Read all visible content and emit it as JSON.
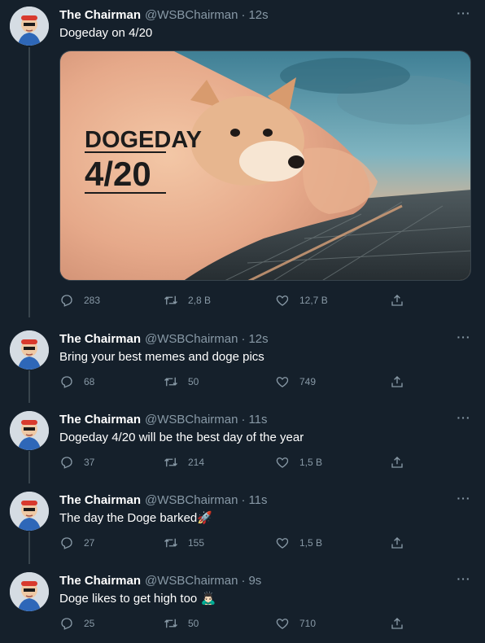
{
  "tweets": [
    {
      "name": "The Chairman",
      "handle": "@WSBChairman",
      "separator": "·",
      "time": "12s",
      "text": "Dogeday on 4/20",
      "media": {
        "line1": "DOGEDAY",
        "line2": "4/20"
      },
      "reply_count": "283",
      "retweet_count": "2,8 B",
      "like_count": "12,7 B"
    },
    {
      "name": "The Chairman",
      "handle": "@WSBChairman",
      "separator": "·",
      "time": "12s",
      "text": "Bring your best memes and doge pics",
      "reply_count": "68",
      "retweet_count": "50",
      "like_count": "749"
    },
    {
      "name": "The Chairman",
      "handle": "@WSBChairman",
      "separator": "·",
      "time": "11s",
      "text": "Dogeday 4/20 will be the best day of the year",
      "reply_count": "37",
      "retweet_count": "214",
      "like_count": "1,5 B"
    },
    {
      "name": "The Chairman",
      "handle": "@WSBChairman",
      "separator": "·",
      "time": "11s",
      "text": "The day the Doge barked🚀",
      "reply_count": "27",
      "retweet_count": "155",
      "like_count": "1,5 B"
    },
    {
      "name": "The Chairman",
      "handle": "@WSBChairman",
      "separator": "·",
      "time": "9s",
      "text": "Doge likes to get high too 🙇🏻‍♂️",
      "reply_count": "25",
      "retweet_count": "50",
      "like_count": "710"
    }
  ],
  "more_glyph": "···",
  "colors": {
    "background": "#15202b",
    "secondary_text": "#8899a6",
    "thread_line": "#38444d"
  },
  "icons": [
    "reply-icon",
    "retweet-icon",
    "like-icon",
    "share-icon",
    "more-icon"
  ]
}
